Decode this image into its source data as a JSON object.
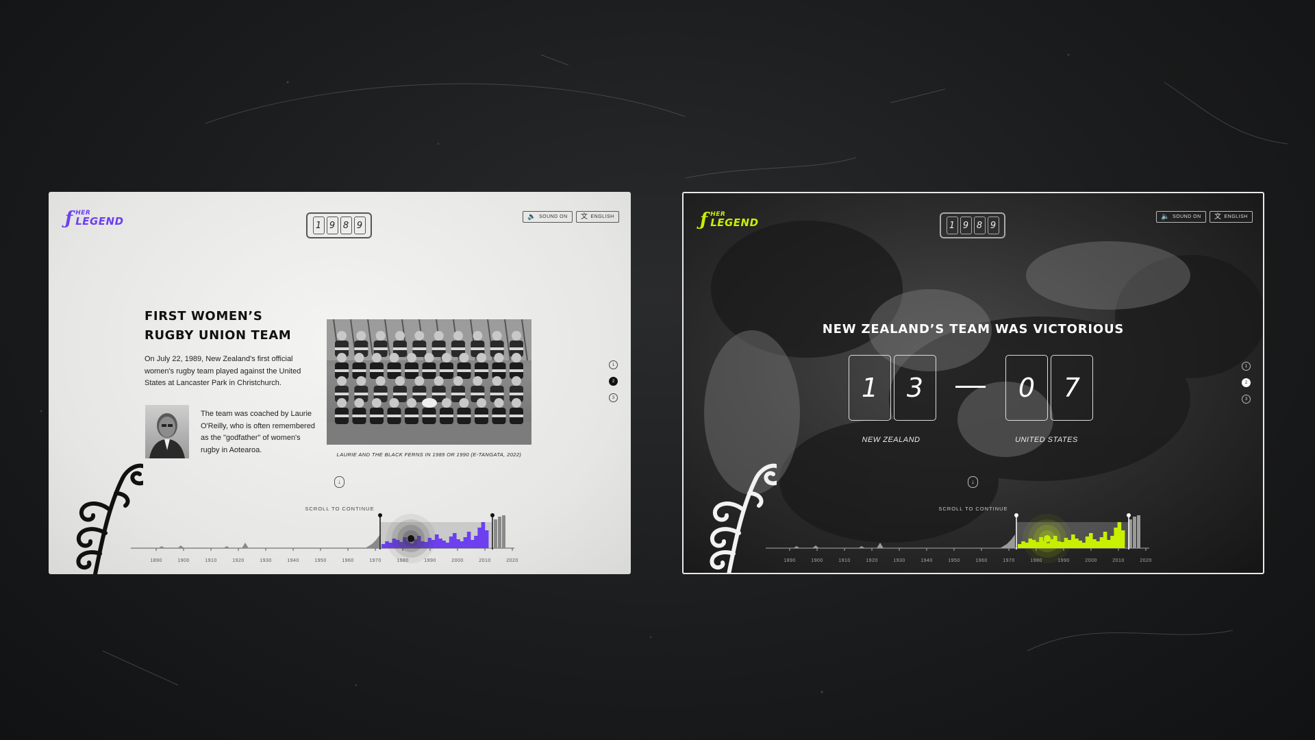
{
  "light": {
    "logo": {
      "mark": "ƒ",
      "line1": "HER",
      "line2": "LEGEND"
    },
    "year_digits": [
      "1",
      "9",
      "8",
      "9"
    ],
    "sound_label": "SOUND ON",
    "language_label": "ENGLISH",
    "title": "FIRST WOMEN’S RUGBY UNION TEAM",
    "body": "On July 22, 1989, New Zealand's first official women's rugby team played against the United States at Lancaster Park in Christchurch.",
    "coach_text": "The team was coached by Laurie O'Reilly, who is often remembered as the \"godfather\" of women's rugby in Aotearoa.",
    "photo_caption": "LAURIE AND THE BLACK FERNS IN 1989 OR 1990 (E-TANGATA, 2022)",
    "pager": [
      "1",
      "2",
      "3"
    ],
    "pager_active": 1,
    "scroll_label": "SCROLL TO CONTINUE",
    "accent": "#6c3ff0"
  },
  "dark": {
    "logo": {
      "mark": "ƒ",
      "line1": "HER",
      "line2": "LEGEND"
    },
    "year_digits": [
      "1",
      "9",
      "8",
      "9"
    ],
    "sound_label": "SOUND ON",
    "language_label": "ENGLISH",
    "headline": "NEW ZEALAND’S TEAM WAS VICTORIOUS",
    "score_home": [
      "1",
      "3"
    ],
    "score_away": [
      "0",
      "7"
    ],
    "team_home": "NEW ZEALAND",
    "team_away": "UNITED STATES",
    "pager": [
      "1",
      "2",
      "3"
    ],
    "pager_active": 1,
    "scroll_label": "SCROLL TO CONTINUE",
    "accent": "#c8f000"
  },
  "timeline": {
    "tick_labels": [
      "1890",
      "1900",
      "1910",
      "1920",
      "1930",
      "1940",
      "1950",
      "1960",
      "1970",
      "1980",
      "1990",
      "2000",
      "2010",
      "2020"
    ],
    "selected_year": 1989
  }
}
